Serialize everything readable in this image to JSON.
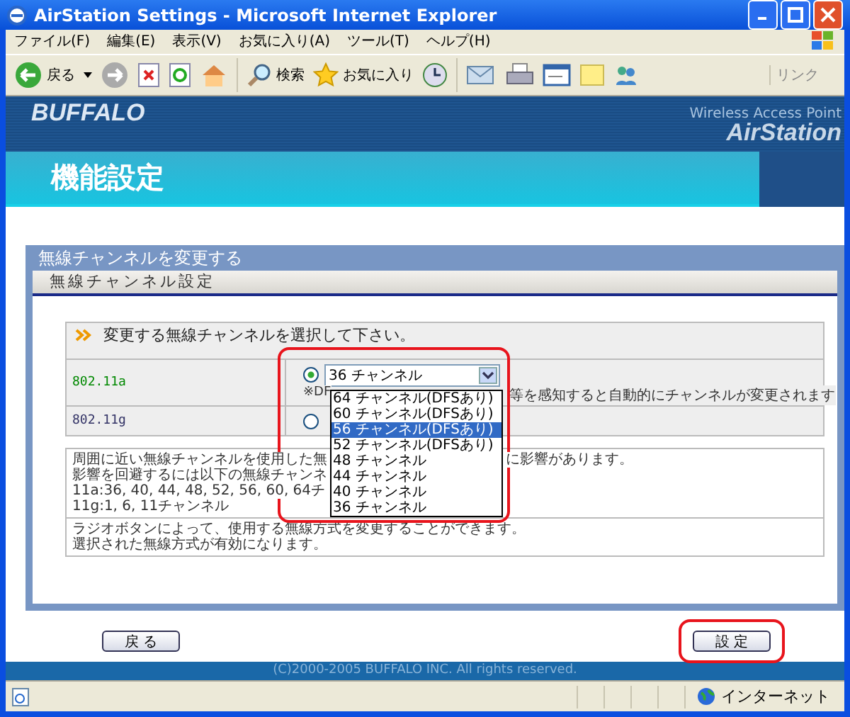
{
  "window": {
    "title": "AirStation Settings - Microsoft Internet Explorer"
  },
  "menu": [
    "ファイル(F)",
    "編集(E)",
    "表示(V)",
    "お気に入り(A)",
    "ツール(T)",
    "ヘルプ(H)"
  ],
  "toolbar": {
    "back": "戻る",
    "search": "検索",
    "favorites": "お気に入り",
    "links": "リンク"
  },
  "header": {
    "brand": "BUFFALO",
    "product_line": "Wireless Access Point",
    "product": "AirStation",
    "page_title": "機能設定"
  },
  "panel": {
    "title": "無線チャンネルを変更する",
    "subtitle": "無線チャンネル設定",
    "instruction": "変更する無線チャンネルを選択して下さい。"
  },
  "modes": [
    {
      "label": "802.11a",
      "selected": true,
      "channel": "36 チャンネル",
      "note_left": "※DF",
      "note_right": "等を感知すると自動的にチャンネルが変更されます"
    },
    {
      "label": "802.11g",
      "selected": false
    }
  ],
  "dropdown": {
    "highlighted": true,
    "options": [
      {
        "label": "64 チャンネル(DFSあり)",
        "selected": false
      },
      {
        "label": "60 チャンネル(DFSあり)",
        "selected": false
      },
      {
        "label": "56 チャンネル(DFSあり)",
        "selected": true
      },
      {
        "label": "52 チャンネル(DFSあり)",
        "selected": false
      },
      {
        "label": "48 チャンネル",
        "selected": false
      },
      {
        "label": "44 チャンネル",
        "selected": false
      },
      {
        "label": "40 チャンネル",
        "selected": false
      },
      {
        "label": "36 チャンネル",
        "selected": false
      }
    ]
  },
  "info_lines": [
    {
      "left": "周囲に近い無線チャンネルを使用した無",
      "right": "に影響があります。"
    },
    {
      "left": "影響を回避するには以下の無線チャンネ"
    },
    {
      "left": "11a:36, 40, 44, 48, 52, 56, 60, 64チ"
    },
    {
      "left": "11g:1, 6, 11チャンネル"
    }
  ],
  "radio_note": [
    "ラジオボタンによって、使用する無線方式を変更することができます。",
    "選択された無線方式が有効になります。"
  ],
  "buttons": {
    "back": "戻 る",
    "apply": "設 定",
    "apply_highlighted": true
  },
  "footer": "(C)2000-2005 BUFFALO INC. All rights reserved.",
  "status_bar": {
    "zone": "インターネット"
  }
}
